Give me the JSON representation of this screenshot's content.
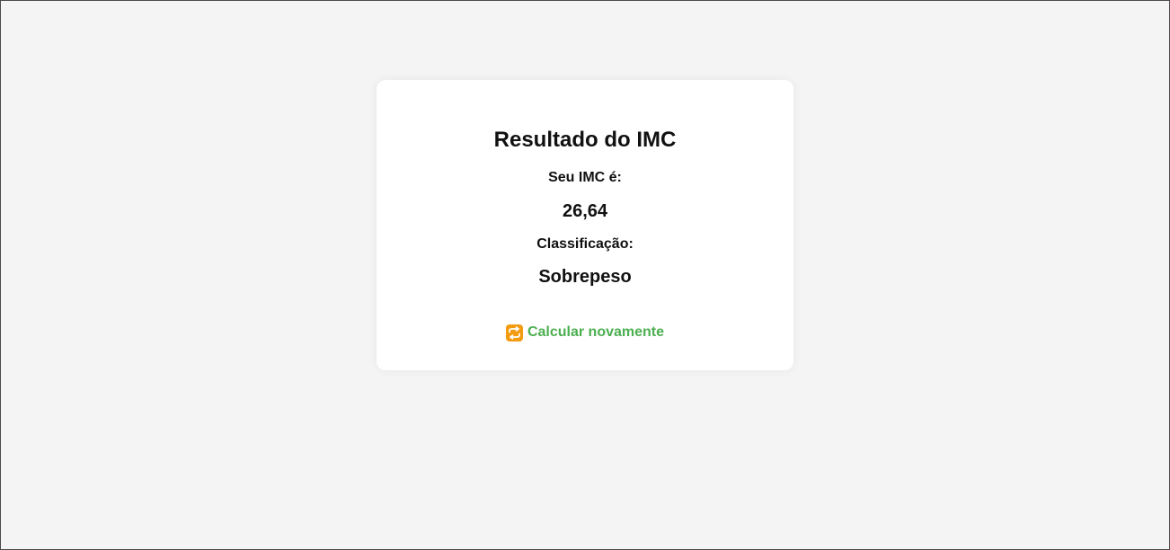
{
  "result": {
    "title": "Resultado do IMC",
    "imc_label": "Seu IMC é:",
    "imc_value": "26,64",
    "classification_label": "Classificação:",
    "classification_value": "Sobrepeso"
  },
  "actions": {
    "recalculate_label": "Calcular novamente",
    "recalculate_icon": "repeat-icon"
  },
  "colors": {
    "page_background": "#f4f4f4",
    "card_background": "#ffffff",
    "link_green": "#4caf50",
    "icon_orange": "#f39c12"
  }
}
